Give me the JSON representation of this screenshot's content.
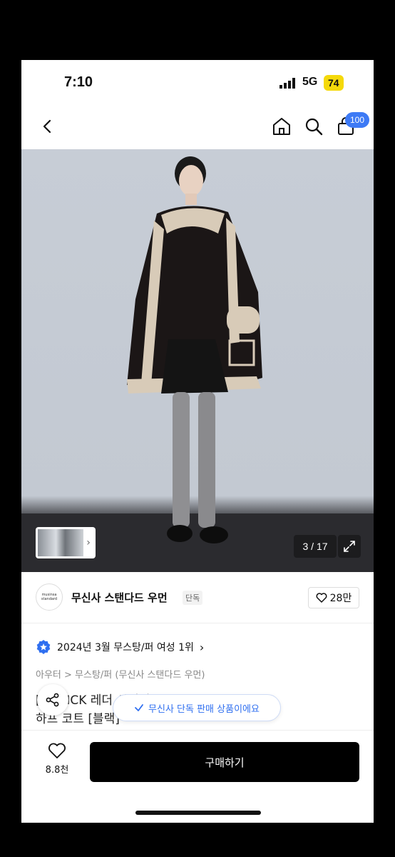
{
  "status_bar": {
    "time": "7:10",
    "network": "5G",
    "battery": "74"
  },
  "nav": {
    "cart_badge": "100"
  },
  "gallery": {
    "counter": "3 / 17"
  },
  "brand": {
    "logo_line1": "musinsa",
    "logo_line2": "standard",
    "name": "무신사 스탠다드 우먼",
    "tag": "단독",
    "likes": "28만"
  },
  "ranking": {
    "text": "2024년 3월 무스탕/퍼 여성 1위"
  },
  "breadcrumb": {
    "text": "아우터 > 무스탕/퍼 (무신사 스탠다드 우먼)"
  },
  "product": {
    "title_line1": "[   희 PICK                       레더 시어링",
    "title_line2": "하프 코트 [블랙]"
  },
  "toast": {
    "text": "무신사 단독 판매 상품이에요"
  },
  "bottom": {
    "wish_count": "8.8천",
    "buy_label": "구매하기"
  },
  "colors": {
    "accent": "#3d7af5",
    "battery": "#f5d90a",
    "buy_button": "#000000"
  },
  "icons": [
    "back-icon",
    "home-icon",
    "search-icon",
    "cart-icon",
    "expand-icon",
    "heart-icon",
    "share-icon",
    "check-icon",
    "medal-icon"
  ]
}
